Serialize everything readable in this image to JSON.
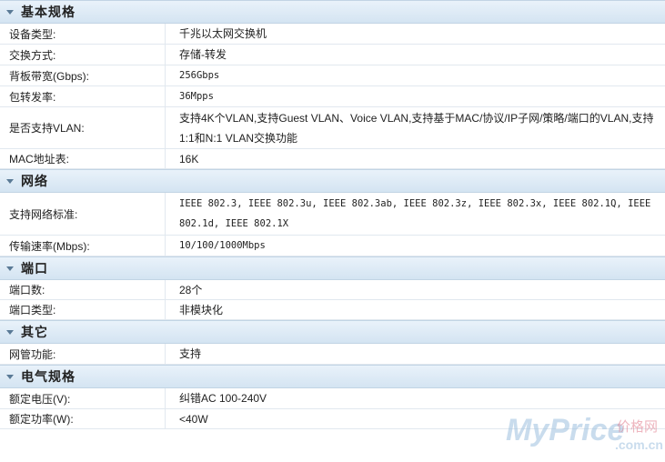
{
  "sections": [
    {
      "title": "基本规格",
      "rows": [
        {
          "label": "设备类型:",
          "value": "千兆以太网交换机"
        },
        {
          "label": "交换方式:",
          "value": "存储-转发"
        },
        {
          "label": "背板带宽(Gbps):",
          "value": "256Gbps"
        },
        {
          "label": "包转发率:",
          "value": "36Mpps"
        },
        {
          "label": "是否支持VLAN:",
          "value": "支持4K个VLAN,支持Guest VLAN、Voice VLAN,支持基于MAC/协议/IP子网/策略/端口的VLAN,支持1:1和N:1 VLAN交换功能"
        },
        {
          "label": "MAC地址表:",
          "value": "16K"
        }
      ]
    },
    {
      "title": "网络",
      "rows": [
        {
          "label": "支持网络标准:",
          "value": "IEEE 802.3, IEEE 802.3u, IEEE 802.3ab, IEEE 802.3z, IEEE 802.3x, IEEE 802.1Q, IEEE 802.1d, IEEE 802.1X"
        },
        {
          "label": "传输速率(Mbps):",
          "value": "10/100/1000Mbps"
        }
      ]
    },
    {
      "title": "端口",
      "rows": [
        {
          "label": "端口数:",
          "value": "28个"
        },
        {
          "label": "端口类型:",
          "value": "非模块化"
        }
      ]
    },
    {
      "title": "其它",
      "rows": [
        {
          "label": "网管功能:",
          "value": "支持"
        }
      ]
    },
    {
      "title": "电气规格",
      "rows": [
        {
          "label": "额定电压(V):",
          "value": "纠错AC 100-240V"
        },
        {
          "label": "额定功率(W):",
          "value": "<40W"
        }
      ]
    }
  ],
  "watermark": {
    "brand": "MyPrice",
    "cn": "价格网",
    "domain": ".com.cn"
  }
}
